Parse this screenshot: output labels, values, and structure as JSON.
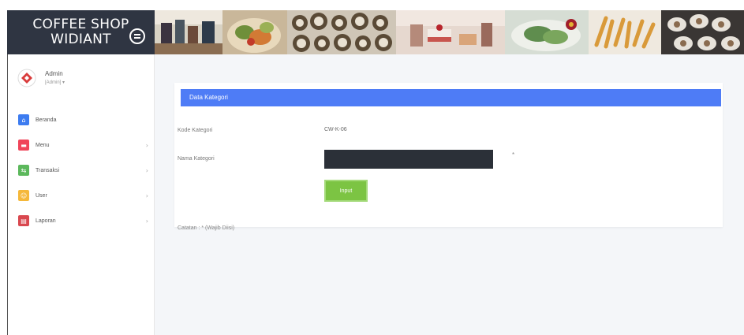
{
  "brand": {
    "line1": "COFFEE SHOP",
    "line2": "WIDIANT"
  },
  "banner": {
    "photos": [
      "drinks-photo",
      "salad-photo",
      "pastry-photo",
      "dessert-photo",
      "greens-photo",
      "fries-photo",
      "tray-photo"
    ]
  },
  "profile": {
    "name": "Admin",
    "role": "[Admin] ▾"
  },
  "menu": [
    {
      "label": "Beranda",
      "icon": "home-icon",
      "color": "#3d7cf0",
      "chevron": ""
    },
    {
      "label": "Menu",
      "icon": "menu-icon",
      "color": "#f0455a",
      "chevron": "›"
    },
    {
      "label": "Transaksi",
      "icon": "transaction-icon",
      "color": "#5cb85c",
      "chevron": "›"
    },
    {
      "label": "User",
      "icon": "user-icon",
      "color": "#f5b83a",
      "chevron": "›"
    },
    {
      "label": "Laporan",
      "icon": "report-icon",
      "color": "#d9484f",
      "chevron": "›"
    }
  ],
  "form": {
    "title": "Data Kategori",
    "kode_label": "Kode Kategori",
    "kode_value": "CW-K-06",
    "nama_label": "Nama Kategori",
    "nama_value": "",
    "required_mark": "*",
    "submit_label": "Input",
    "note": "Catatan : * (Wajib Diisi)"
  },
  "colors": {
    "header_bg": "#2f3542",
    "accent": "#4e7cf6",
    "button": "#7cc443",
    "content_bg": "#f4f6f9"
  }
}
